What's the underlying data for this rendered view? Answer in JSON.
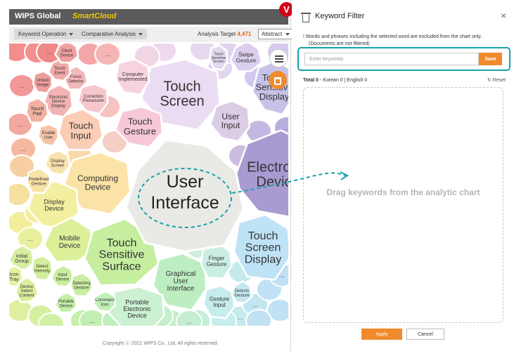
{
  "app": {
    "brand": "WIPS Global",
    "brand_product": "SmartCloud",
    "toolbar": {
      "dropdown_1": "Keyword Operation",
      "dropdown_2": "Comparative Analysis",
      "analysis_target_label": "Analysis Target",
      "analysis_target_value": "4,471",
      "view_select": "Abstract"
    },
    "footer": "Copyright ⓒ 2021 WIPS Co., Ltd. All rights reserved."
  },
  "badge": {
    "letter": "V",
    "color": "#d0021b"
  },
  "chart_data": {
    "type": "voronoi-treemap",
    "center": "User Interface",
    "cells": [
      {
        "label": "Touch Screen",
        "color": "#eadcf2"
      },
      {
        "label": "Touch Gesture",
        "color": "#f7c9d8"
      },
      {
        "label": "Touch Input",
        "color": "#fbcdb6"
      },
      {
        "label": "User Input",
        "color": "#dccde6"
      },
      {
        "label": "Electronic Device",
        "color": "#a99ad2"
      },
      {
        "label": "Computing Device",
        "color": "#fbe2a6"
      },
      {
        "label": "Display Device",
        "color": "#f2f0a0"
      },
      {
        "label": "Mobile Device",
        "color": "#dcf09a"
      },
      {
        "label": "Touch Sensitive Surface",
        "color": "#c5ee9f"
      },
      {
        "label": "Graphical User Interface",
        "color": "#bdeec2"
      },
      {
        "label": "Portable Electronic Device",
        "color": "#ccf0d2"
      },
      {
        "label": "Finger Gesture",
        "color": "#caeee4"
      },
      {
        "label": "Gesture Input",
        "color": "#c6ecec"
      },
      {
        "label": "Touch Screen Display",
        "color": "#bfe3f6"
      },
      {
        "label": "Touch Sensitive Display",
        "color": "#c7c3e8"
      },
      {
        "label": "Swipe Gesture",
        "color": "#dccfee"
      },
      {
        "label": "Computer Implemented",
        "color": "#f7d3df"
      },
      {
        "label": "Correction Possession",
        "color": "#f6c7cb"
      },
      {
        "label": "Electronic Device Display",
        "color": "#f3b3b3"
      },
      {
        "label": "Focus Selector",
        "color": "#f4b7ba"
      },
      {
        "label": "Touch Event",
        "color": "#f1a9a9"
      },
      {
        "label": "Client Device",
        "color": "#f0a0a0"
      },
      {
        "label": "Unlock Image",
        "color": "#ef9e9e"
      },
      {
        "label": "Touch Pad",
        "color": "#f2b1a3"
      },
      {
        "label": "Enable User",
        "color": "#f6c3a8"
      },
      {
        "label": "Predefined Gesture",
        "color": "#f8e2a6"
      },
      {
        "label": "Display Screen",
        "color": "#f9e3ad"
      },
      {
        "label": "Initial Group",
        "color": "#d6ee9e"
      },
      {
        "label": "Detect Intensity",
        "color": "#d2ee9c"
      },
      {
        "label": "Input Device",
        "color": "#c8ee9e"
      },
      {
        "label": "Icon Tray",
        "color": "#e6f19e"
      },
      {
        "label": "Device Select Content",
        "color": "#dbef9c"
      },
      {
        "label": "Detecting Gesture",
        "color": "#c9eea1"
      },
      {
        "label": "Portable Device",
        "color": "#c4efa8"
      },
      {
        "label": "Command Icon",
        "color": "#c1efb8"
      },
      {
        "label": "Touch Sensitive Screen",
        "color": "#e3d8ef"
      },
      {
        "label": "Detects Gesture",
        "color": "#c4e8ef"
      }
    ]
  },
  "panel": {
    "title": "Keyword Filter",
    "close": "×",
    "note_line1": "! Words and phrases including the selected word are excluded from the chart only.",
    "note_line2": "(Documents are not filtered)",
    "input_placeholder": "Enter keywords",
    "save_label": "Save",
    "total_label": "Total 0",
    "total_detail": "- Korean 0 | English 0",
    "reset_label": "↻ Reset",
    "drag_text": "Drag keywords from the analytic chart",
    "apply_label": "Apply",
    "cancel_label": "Cancel",
    "accent": "#f08a2c",
    "highlight": "#17a3a8"
  }
}
